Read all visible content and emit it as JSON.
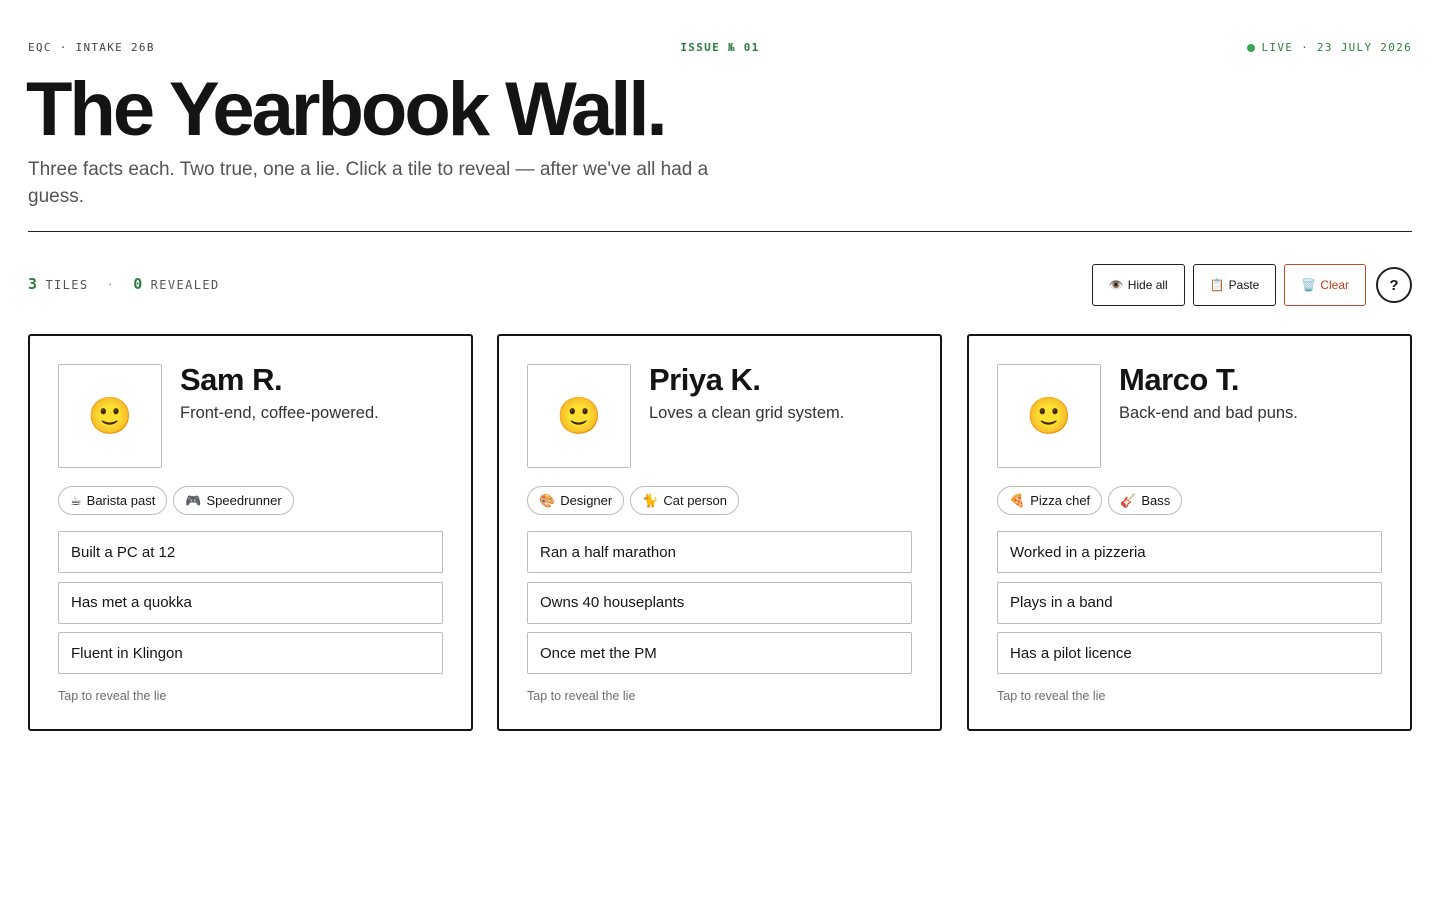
{
  "header": {
    "left": "EQC · INTAKE 26B",
    "center": "ISSUE № 01",
    "right": "LIVE · 23 JULY 2026",
    "live_color": "#3aa356"
  },
  "title": "The Yearbook Wall.",
  "subtitle": "Three facts each. Two true, one a lie. Click a tile to reveal — after we've all had a guess.",
  "stats": {
    "tiles_count": "3",
    "tiles_label": "TILES",
    "separator": "·",
    "revealed_count": "0",
    "revealed_label": "REVEALED"
  },
  "actions": {
    "hide_all": {
      "icon": "👁️",
      "icon_name": "eye-icon",
      "label": "Hide all"
    },
    "paste": {
      "icon": "📋",
      "icon_name": "clipboard-icon",
      "label": "Paste"
    },
    "clear": {
      "icon": "🗑️",
      "icon_name": "trash-icon",
      "label": "Clear",
      "color": "#c23a1e"
    },
    "help": {
      "label": "?"
    }
  },
  "cards": [
    {
      "avatar": "🙂",
      "name": "Sam R.",
      "bio": "Front-end, coffee-powered.",
      "chips": [
        {
          "icon": "☕",
          "label": "Barista past"
        },
        {
          "icon": "🎮",
          "label": "Speedrunner"
        }
      ],
      "facts": [
        "Built a PC at 12",
        "Has met a quokka",
        "Fluent in Klingon"
      ],
      "hint": "Tap to reveal the lie"
    },
    {
      "avatar": "🙂",
      "name": "Priya K.",
      "bio": "Loves a clean grid system.",
      "chips": [
        {
          "icon": "🎨",
          "label": "Designer"
        },
        {
          "icon": "🐈",
          "label": "Cat person"
        }
      ],
      "facts": [
        "Ran a half marathon",
        "Owns 40 houseplants",
        "Once met the PM"
      ],
      "hint": "Tap to reveal the lie"
    },
    {
      "avatar": "🙂",
      "name": "Marco T.",
      "bio": "Back-end and bad puns.",
      "chips": [
        {
          "icon": "🍕",
          "label": "Pizza chef"
        },
        {
          "icon": "🎸",
          "label": "Bass"
        }
      ],
      "facts": [
        "Worked in a pizzeria",
        "Plays in a band",
        "Has a pilot licence"
      ],
      "hint": "Tap to reveal the lie"
    }
  ]
}
